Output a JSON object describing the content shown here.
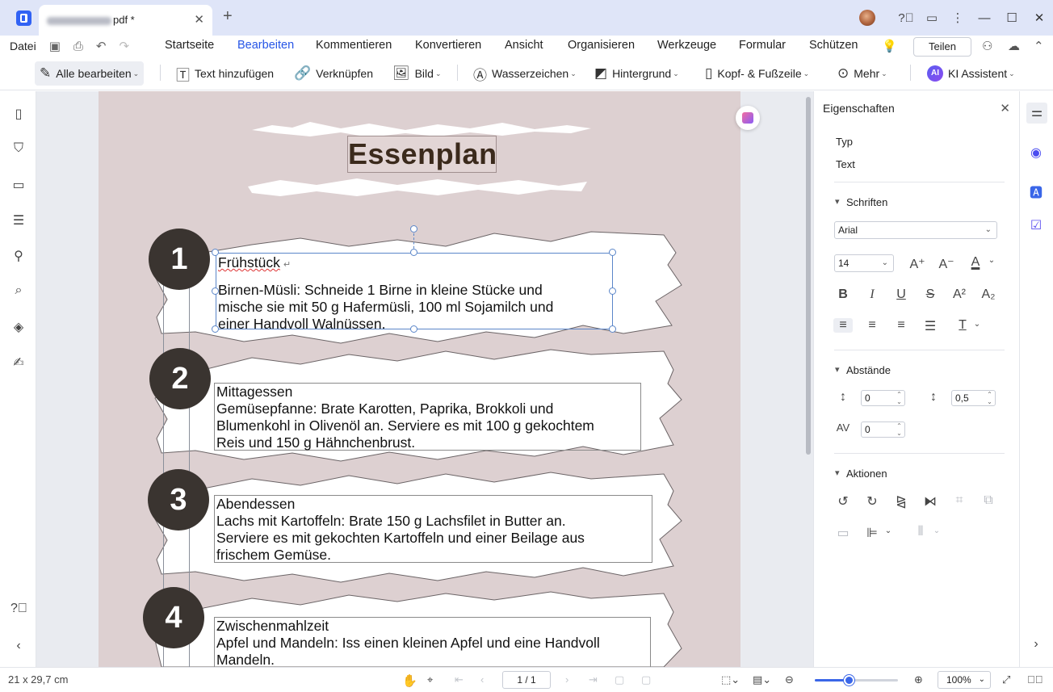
{
  "titlebar": {
    "tab_name": "pdf *",
    "close": "✕",
    "new_tab": "+"
  },
  "menu": {
    "file": "Datei",
    "tabs": [
      "Startseite",
      "Bearbeiten",
      "Kommentieren",
      "Konvertieren",
      "Ansicht",
      "Organisieren",
      "Werkzeuge",
      "Formular",
      "Schützen"
    ],
    "active_tab": "Bearbeiten",
    "share": "Teilen"
  },
  "toolbar": {
    "edit_all": "Alle bearbeiten",
    "add_text": "Text hinzufügen",
    "link": "Verknüpfen",
    "image": "Bild",
    "watermark": "Wasserzeichen",
    "background": "Hintergrund",
    "header_footer": "Kopf- & Fußzeile",
    "more": "Mehr",
    "ai_badge": "AI",
    "ai": "KI Assistent"
  },
  "document": {
    "title": "Essenplan",
    "sections": [
      {
        "number": "1",
        "heading": "Frühstück",
        "lines": [
          "Birnen-Müsli: Schneide 1 Birne in kleine Stücke und",
          "mische sie mit 50 g Hafermüsli, 100 ml Sojamilch und",
          "einer Handvoll Walnüssen."
        ]
      },
      {
        "number": "2",
        "heading": "Mittagessen",
        "lines": [
          "Gemüsepfanne: Brate Karotten, Paprika, Brokkoli und",
          "Blumenkohl in Olivenöl an. Serviere es mit 100 g gekochtem",
          "Reis und 150 g Hähnchenbrust."
        ]
      },
      {
        "number": "3",
        "heading": "Abendessen",
        "lines": [
          "Lachs mit Kartoffeln: Brate 150 g Lachsfilet in Butter an.",
          "Serviere es mit gekochten Kartoffeln und einer Beilage aus",
          "frischem Gemüse."
        ]
      },
      {
        "number": "4",
        "heading": "Zwischenmahlzeit",
        "lines": [
          "Apfel und Mandeln: Iss einen kleinen Apfel und eine Handvoll",
          "Mandeln."
        ]
      }
    ]
  },
  "properties": {
    "title": "Eigenschaften",
    "type_label": "Typ",
    "type_value": "Text",
    "fonts_label": "Schriften",
    "font_family": "Arial",
    "font_size": "14",
    "spacing_label": "Abstände",
    "line_spacing": "0",
    "paragraph_spacing": "0,5",
    "char_spacing": "0",
    "actions_label": "Aktionen"
  },
  "status": {
    "page_size": "21 x 29,7 cm",
    "page_display": "1 / 1",
    "zoom": "100%",
    "zoom_level": 0.41
  }
}
